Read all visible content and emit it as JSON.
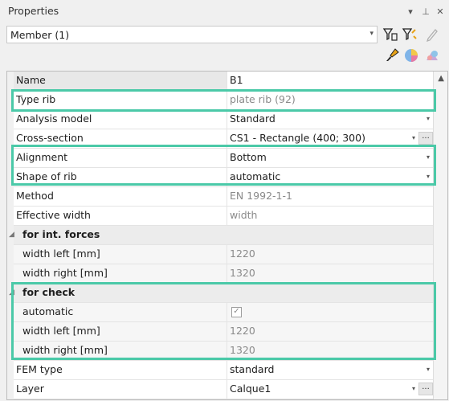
{
  "panel": {
    "title": "Properties"
  },
  "title_buttons": [
    {
      "name": "dropdown-icon",
      "glyph": "▾"
    },
    {
      "name": "pin-icon",
      "glyph": "⊥"
    },
    {
      "name": "close-icon",
      "glyph": "✕"
    }
  ],
  "selector": {
    "value": "Member (1)"
  },
  "toolbar": [
    {
      "name": "select-filter-icon"
    },
    {
      "name": "filter-add-icon"
    },
    {
      "name": "edit-pencil-icon"
    },
    {
      "name": "brush-icon"
    },
    {
      "name": "color-palette-icon"
    },
    {
      "name": "render-icon"
    }
  ],
  "grid": {
    "rows": [
      {
        "label": "Name",
        "value": "B1",
        "selected": true
      },
      {
        "label": "Type rib",
        "value": "plate rib (92)",
        "gray": true
      },
      {
        "label": "Analysis model",
        "value": "Standard",
        "dropdown": true
      },
      {
        "label": "Cross-section",
        "value": "CS1 - Rectangle (400; 300)",
        "dropdown": true,
        "ellipsis": true
      },
      {
        "label": "Alignment",
        "value": "Bottom",
        "dropdown": true
      },
      {
        "label": "Shape of rib",
        "value": "automatic",
        "dropdown": true
      },
      {
        "label": "Method",
        "value": "EN 1992-1-1",
        "gray": true
      },
      {
        "label": "Effective width",
        "value": "width",
        "gray": true
      },
      {
        "label": "for int. forces",
        "category": true
      },
      {
        "label": "width left  [mm]",
        "value": "1220",
        "gray": true,
        "sub": true
      },
      {
        "label": "width right [mm]",
        "value": "1320",
        "gray": true,
        "sub": true
      },
      {
        "label": "for check",
        "category": true
      },
      {
        "label": "automatic",
        "checkbox": true,
        "checked": true,
        "sub": true
      },
      {
        "label": "width left  [mm]",
        "value": "1220",
        "gray": true,
        "sub": true
      },
      {
        "label": "width right [mm]",
        "value": "1320",
        "gray": true,
        "sub": true
      },
      {
        "label": "FEM type",
        "value": "standard",
        "dropdown": true
      },
      {
        "label": "Layer",
        "value": "Calque1",
        "dropdown": true,
        "ellipsis": true
      }
    ]
  },
  "highlight_color": "#4bc9a8"
}
